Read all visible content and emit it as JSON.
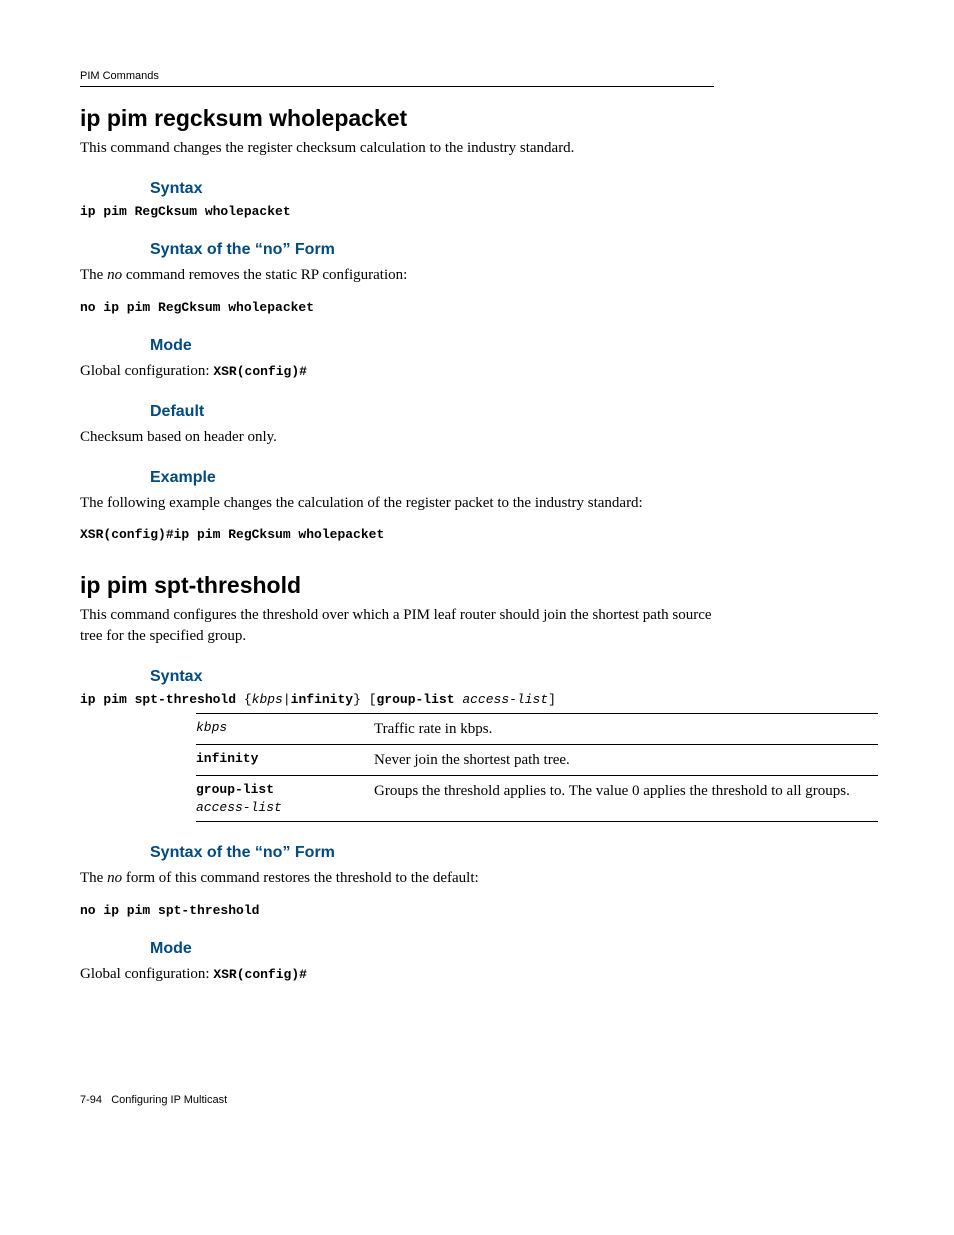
{
  "header": {
    "running": "PIM Commands"
  },
  "cmd1": {
    "title": "ip pim regcksum wholepacket",
    "intro": "This command changes the register checksum calculation to the industry standard.",
    "syntax_h": "Syntax",
    "syntax_line": "ip pim RegCksum wholepacket",
    "noform_h": "Syntax of the “no” Form",
    "noform_pre": "The ",
    "noform_word": "no",
    "noform_post": " command removes the static RP configuration:",
    "noform_line": "no ip pim RegCksum wholepacket",
    "mode_h": "Mode",
    "mode_text": "Global configuration: ",
    "mode_prompt": "XSR(config)#",
    "default_h": "Default",
    "default_text": "Checksum based on header only.",
    "example_h": "Example",
    "example_text": "The following example changes the calculation of the register packet to the industry standard:",
    "example_line": "XSR(config)#ip pim RegCksum wholepacket"
  },
  "cmd2": {
    "title": "ip pim spt-threshold",
    "intro": "This command configures the threshold over which a PIM leaf router should join the shortest path source tree for the specified group.",
    "syntax_h": "Syntax",
    "syntax_p1": "ip pim spt-threshold ",
    "syntax_brace_open": "{",
    "syntax_arg1": "kbps",
    "syntax_pipe": "|",
    "syntax_arg2": "infinity",
    "syntax_brace_close": "} [",
    "syntax_arg3": "group-list ",
    "syntax_arg4": "access-list",
    "syntax_close": "]",
    "rows": [
      {
        "k": "kbps",
        "k_italic": true,
        "d": "Traffic rate in kbps."
      },
      {
        "k": "infinity",
        "k_italic": false,
        "d": "Never join the shortest path tree."
      },
      {
        "k1": "group-list",
        "k2": "access-list",
        "d": "Groups the threshold applies to. The value 0 applies the threshold to all groups."
      }
    ],
    "noform_h": "Syntax of the “no” Form",
    "noform_pre": "The ",
    "noform_word": "no",
    "noform_post": " form of this command restores the threshold to the default:",
    "noform_line": "no ip pim spt-threshold",
    "mode_h": "Mode",
    "mode_text": "Global configuration: ",
    "mode_prompt": "XSR(config)#"
  },
  "footer": {
    "pagenum": "7-94",
    "chapter": "Configuring IP Multicast"
  }
}
